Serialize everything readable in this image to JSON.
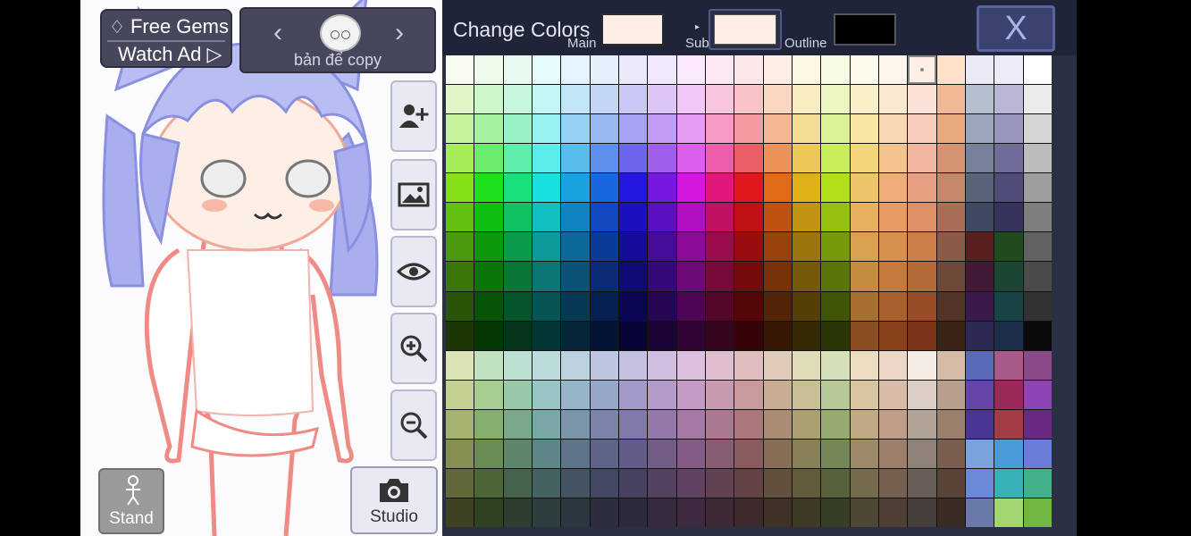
{
  "ad": {
    "gems_label": "Free Gems",
    "watch_label": "Watch Ad ▷"
  },
  "preset": {
    "name": "bản để copy",
    "prev": "‹",
    "next": "›"
  },
  "buttons": {
    "stand": "Stand",
    "studio": "Studio"
  },
  "color_panel": {
    "title": "Change Colors",
    "main_label": "Main",
    "sub_label": "Sub",
    "outline_label": "Outline",
    "close": "X",
    "main_color": "#ffeee6",
    "sub_color": "#ffeee6",
    "outline_color": "#000000",
    "selected": [
      16,
      0
    ]
  },
  "palette": [
    [
      "#f8fbf0",
      "#eefbea",
      "#e8fbf0",
      "#e6fbfb",
      "#e4f4fc",
      "#e6effc",
      "#eaeafc",
      "#f0e8fc",
      "#fae9fc",
      "#fce8f2",
      "#fce8ea",
      "#fceee4",
      "#fcf8e4",
      "#f8fbe4",
      "#fcfae8",
      "#fcf6ec",
      "#ffeee6",
      "#ffe0c8",
      "#eaeaf6",
      "#ececf8",
      "#ffffff"
    ],
    [
      "#e0f6c8",
      "#cdf6cd",
      "#c6f6de",
      "#c4f6f6",
      "#c2e6f8",
      "#c4d6f8",
      "#cbc8f8",
      "#dcc6f8",
      "#f2c6f6",
      "#f8c4de",
      "#f8c4c6",
      "#f8d6c0",
      "#f8ecc0",
      "#ecf6c0",
      "#faf0c8",
      "#fae8d0",
      "#fce2d6",
      "#f0b894",
      "#b4bfd0",
      "#b8b6d2",
      "#ebebeb"
    ],
    [
      "#c6f29a",
      "#a6f2a2",
      "#9af2c4",
      "#98f2f2",
      "#96d2f4",
      "#98b8f4",
      "#a6a2f4",
      "#c29cf4",
      "#e69cf2",
      "#f49ac4",
      "#f49aa0",
      "#f4b694",
      "#f4dc94",
      "#dcf296",
      "#f8e6a2",
      "#f8d8b2",
      "#f8ccbc",
      "#e8a880",
      "#9aa6bc",
      "#9896bc",
      "#d6d6d6"
    ],
    [
      "#a4ec5a",
      "#6cec6c",
      "#60ecaa",
      "#5cecec",
      "#58bcec",
      "#5c90ec",
      "#6c66ec",
      "#a05eec",
      "#dc5eec",
      "#ec5eaa",
      "#ec5e66",
      "#ec9258",
      "#ecc858",
      "#c8ec5a",
      "#f4d67a",
      "#f4c28c",
      "#f0b6a0",
      "#d49472",
      "#76829a",
      "#6e6c98",
      "#bcbcbc"
    ],
    [
      "#86e018",
      "#1ee01e",
      "#18e07c",
      "#18e0e0",
      "#18a2e0",
      "#1866e0",
      "#2418e0",
      "#7618e0",
      "#d418e0",
      "#e0187c",
      "#e0181e",
      "#e06a18",
      "#e0b018",
      "#b0e018",
      "#eec46a",
      "#eeac78",
      "#e8a080",
      "#c48868",
      "#586478",
      "#4e4c78",
      "#9e9e9e"
    ],
    [
      "#62c010",
      "#10c010",
      "#10c062",
      "#10c0c0",
      "#1084c0",
      "#1048c0",
      "#1a10c0",
      "#5a10c0",
      "#b010c0",
      "#c01062",
      "#c01014",
      "#c05210",
      "#c09410",
      "#94c010",
      "#e8b060",
      "#e89c64",
      "#e09066",
      "#a86e58",
      "#3e4860",
      "#36345c",
      "#7e7e7e"
    ],
    [
      "#4c9a0c",
      "#0c9a0c",
      "#0c9a4c",
      "#0c9a9a",
      "#0c6a9a",
      "#0c3a9a",
      "#140c9a",
      "#480c9a",
      "#8c0c9a",
      "#9a0c4c",
      "#9a0c10",
      "#9a420c",
      "#9a760c",
      "#769a0c",
      "#d8a050",
      "#d89050",
      "#cc7e48",
      "#8a5c48",
      "#5a2020",
      "#204a20",
      "#626262"
    ],
    [
      "#3a760a",
      "#0a760a",
      "#0a763a",
      "#0a7676",
      "#0a5276",
      "#0a2c76",
      "#0e0a76",
      "#360a76",
      "#6c0a76",
      "#760a3a",
      "#760a0c",
      "#76320a",
      "#765a0a",
      "#5a760a",
      "#c48c40",
      "#c47a3c",
      "#b46a38",
      "#6e4838",
      "#421a36",
      "#1a4632",
      "#4a4a4a"
    ],
    [
      "#2a5406",
      "#065406",
      "#06542a",
      "#065454",
      "#063a54",
      "#062054",
      "#0a0654",
      "#260654",
      "#4e0654",
      "#54062a",
      "#540608",
      "#542406",
      "#544006",
      "#405406",
      "#a87030",
      "#a8602c",
      "#984c28",
      "#523428",
      "#3a1a4a",
      "#164444",
      "#323232"
    ],
    [
      "#1c3604",
      "#043604",
      "#04361c",
      "#043636",
      "#042636",
      "#041436",
      "#060436",
      "#1a0436",
      "#320436",
      "#36041c",
      "#360406",
      "#361804",
      "#362a04",
      "#2a3604",
      "#8a4e20",
      "#8a421c",
      "#7a3418",
      "#3a2418",
      "#2e2854",
      "#1c2e4a",
      "#0a0a0a"
    ],
    [
      "#dce4b6",
      "#c0e2c0",
      "#bce0d2",
      "#bcdcdc",
      "#bcd0e0",
      "#bcc6e0",
      "#c4c0e0",
      "#d0bee0",
      "#ddbedf",
      "#e0bed0",
      "#e0bec0",
      "#e0cab8",
      "#e0dcb8",
      "#d4e0b8",
      "#ecdcc0",
      "#ecd6c8",
      "#f4ece4",
      "#d6bca8",
      "#5a6ab8",
      "#a85a8a",
      "#8a4a8a"
    ],
    [
      "#c4d090",
      "#a6cc90",
      "#98c8a8",
      "#98c4c4",
      "#98b4c8",
      "#98a6c8",
      "#a29ac8",
      "#b49ac8",
      "#c49ac4",
      "#c89ab0",
      "#c89a9c",
      "#c8ac94",
      "#c8c094",
      "#b6c894",
      "#d8c6a0",
      "#d8bca8",
      "#dcd0c4",
      "#b89e8c",
      "#6446a8",
      "#9a2a5a",
      "#8e44b4"
    ],
    [
      "#a6b270",
      "#86ae6e",
      "#7aa888",
      "#7aa6a6",
      "#7a94aa",
      "#7a84aa",
      "#8278aa",
      "#9478aa",
      "#a678a6",
      "#aa7890",
      "#aa787a",
      "#aa8c72",
      "#aaa072",
      "#96aa72",
      "#c0aa84",
      "#c09e8a",
      "#b0a496",
      "#9a7e6c",
      "#4a3494",
      "#a43c48",
      "#6a2a84"
    ],
    [
      "#868e52",
      "#688c52",
      "#5e8668",
      "#5e8686",
      "#5e7488",
      "#5e6488",
      "#645c88",
      "#745c88",
      "#865c86",
      "#885c72",
      "#885c5e",
      "#886e56",
      "#888056",
      "#768856",
      "#9c8a68",
      "#9c806c",
      "#8e8276",
      "#7a5e4e",
      "#7aa2dc",
      "#4a9ad8",
      "#6a7ed8"
    ],
    [
      "#626838",
      "#4c6638",
      "#44624c",
      "#446262",
      "#445462",
      "#444862",
      "#484262",
      "#544262",
      "#624262",
      "#624252",
      "#624244",
      "#62503c",
      "#625c3c",
      "#56623c",
      "#766a4e",
      "#766050",
      "#6a5e58",
      "#5a4438",
      "#6a8ad8",
      "#38b0b8",
      "#44b08a"
    ],
    [
      "#3e4222",
      "#304022",
      "#2c3e30",
      "#2c3e3e",
      "#2c363e",
      "#2c2e3e",
      "#2e2a3e",
      "#362a3e",
      "#3e2a3e",
      "#3e2a34",
      "#3e2a2c",
      "#3e3226",
      "#3e3a26",
      "#363e26",
      "#4e4634",
      "#4e3e34",
      "#463e3a",
      "#3a2c24",
      "#6a7aa8",
      "#a4d670",
      "#70b840"
    ]
  ]
}
